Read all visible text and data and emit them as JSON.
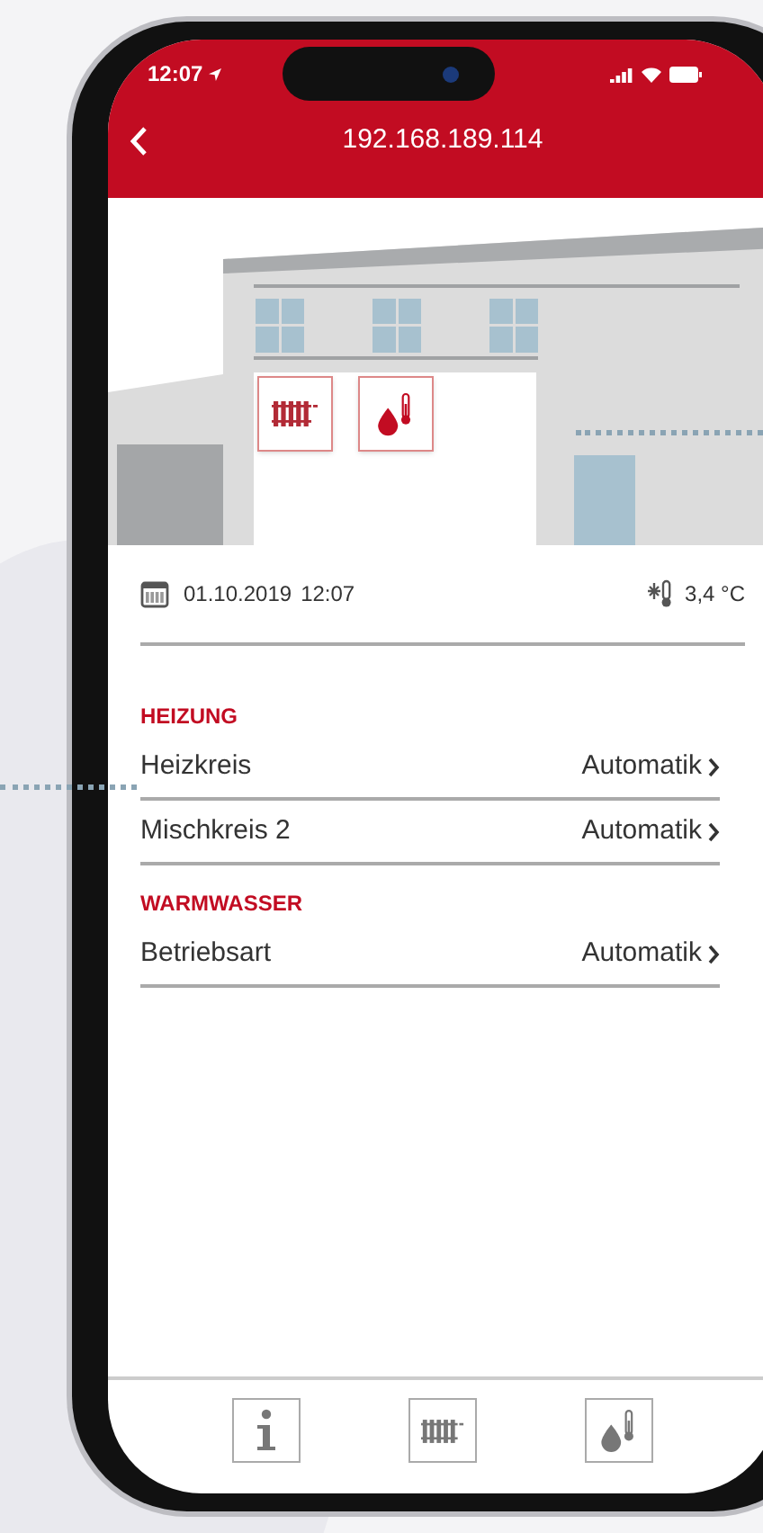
{
  "status_bar": {
    "time": "12:07"
  },
  "header": {
    "title": "192.168.189.114"
  },
  "info": {
    "date": "01.10.2019",
    "time": "12:07",
    "outdoor_temperature": "3,4 °C"
  },
  "sections": [
    {
      "title": "HEIZUNG",
      "rows": [
        {
          "label": "Heizkreis",
          "value": "Automatik"
        },
        {
          "label": "Mischkreis 2",
          "value": "Automatik"
        }
      ]
    },
    {
      "title": "WARMWASSER",
      "rows": [
        {
          "label": "Betriebsart",
          "value": "Automatik"
        }
      ]
    }
  ],
  "tab_bar": [
    {
      "kind": "info"
    },
    {
      "kind": "heating"
    },
    {
      "kind": "water"
    }
  ]
}
